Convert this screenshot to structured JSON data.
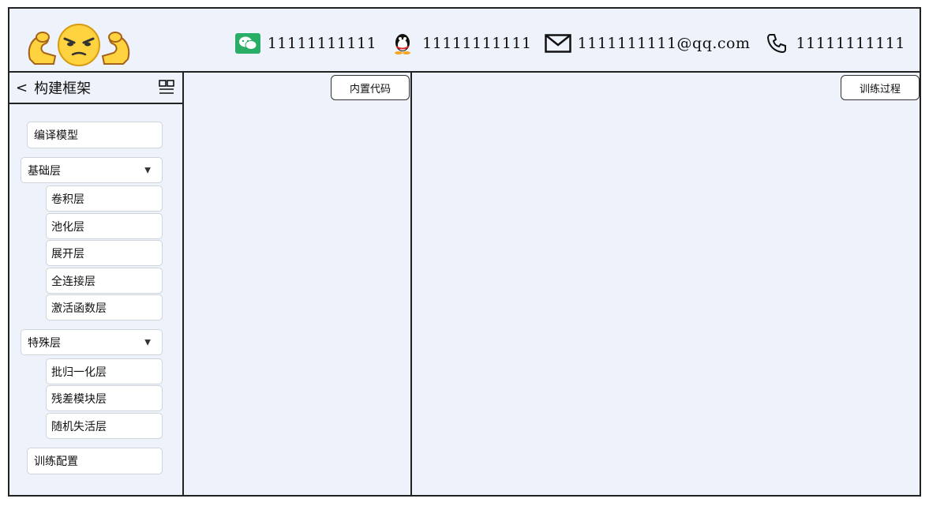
{
  "header": {
    "contacts": [
      {
        "icon": "wechat-icon",
        "value": "11111111111"
      },
      {
        "icon": "qq-icon",
        "value": "11111111111"
      },
      {
        "icon": "mail-icon",
        "value": "1111111111@qq.com"
      },
      {
        "icon": "phone-icon",
        "value": "11111111111"
      }
    ]
  },
  "sidebar": {
    "back_label": "<",
    "title": "构建框架",
    "items": [
      {
        "label": "编译模型"
      },
      {
        "label": "基础层",
        "expanded": true,
        "children": [
          "卷积层",
          "池化层",
          "展开层",
          "全连接层",
          "激活函数层"
        ]
      },
      {
        "label": "特殊层",
        "expanded": true,
        "children": [
          "批归一化层",
          "残差模块层",
          "随机失活层"
        ]
      },
      {
        "label": "训练配置"
      }
    ]
  },
  "panes": {
    "middle_button": "内置代码",
    "right_button": "训练过程"
  },
  "colors": {
    "background": "#eef2fa",
    "border": "#222222",
    "wechat": "#2aae67",
    "logo_face": "#ffd23f"
  }
}
